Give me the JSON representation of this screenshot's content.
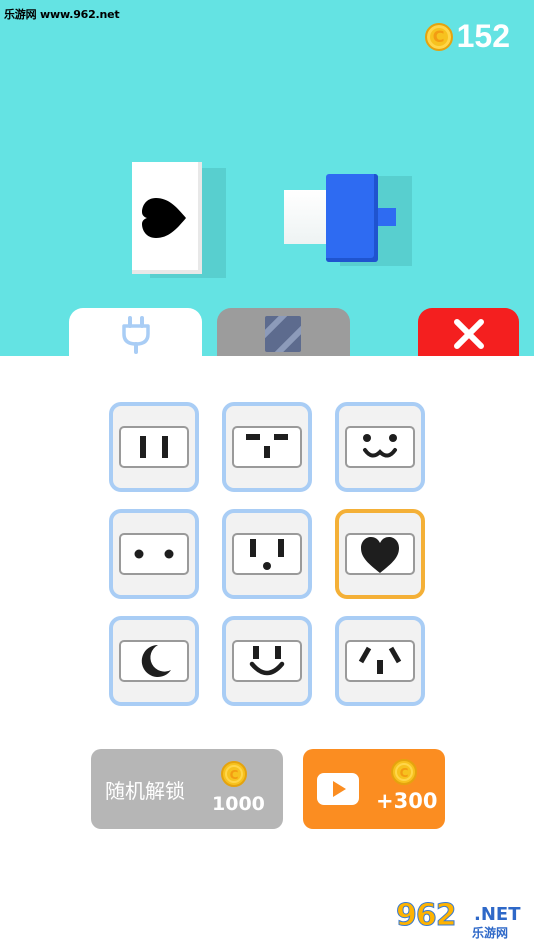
{
  "watermark": "乐游网 www.962.net",
  "coins": {
    "icon": "coin-icon",
    "coin_symbol": "C",
    "balance": "152"
  },
  "preview": {
    "socket_symbol": "heart",
    "plug_color": "#2e6bf2"
  },
  "tabs": [
    {
      "name": "plug-tab",
      "icon": "plug-icon",
      "selected": true
    },
    {
      "name": "style-tab",
      "icon": "striped-square-icon",
      "selected": false
    },
    {
      "name": "close-tab",
      "icon": "close-icon",
      "selected": false
    }
  ],
  "sockets": [
    {
      "id": "two-slots",
      "selected": false
    },
    {
      "id": "t-slots",
      "selected": false
    },
    {
      "id": "bear-face",
      "selected": false
    },
    {
      "id": "two-dots",
      "selected": false
    },
    {
      "id": "exclamation-face",
      "selected": false
    },
    {
      "id": "heart",
      "selected": true
    },
    {
      "id": "moon",
      "selected": false
    },
    {
      "id": "smile",
      "selected": false
    },
    {
      "id": "angled-slots",
      "selected": false
    }
  ],
  "buttons": {
    "random_unlock_label": "随机解锁",
    "random_unlock_cost": "1000",
    "ad_reward": "+300"
  },
  "logo": {
    "number": "962",
    "net": ".NET",
    "sub": "乐游网"
  },
  "colors": {
    "sky": "#64e3e3",
    "selected_border": "#f4b037",
    "cell_border": "#a9cdf5"
  }
}
